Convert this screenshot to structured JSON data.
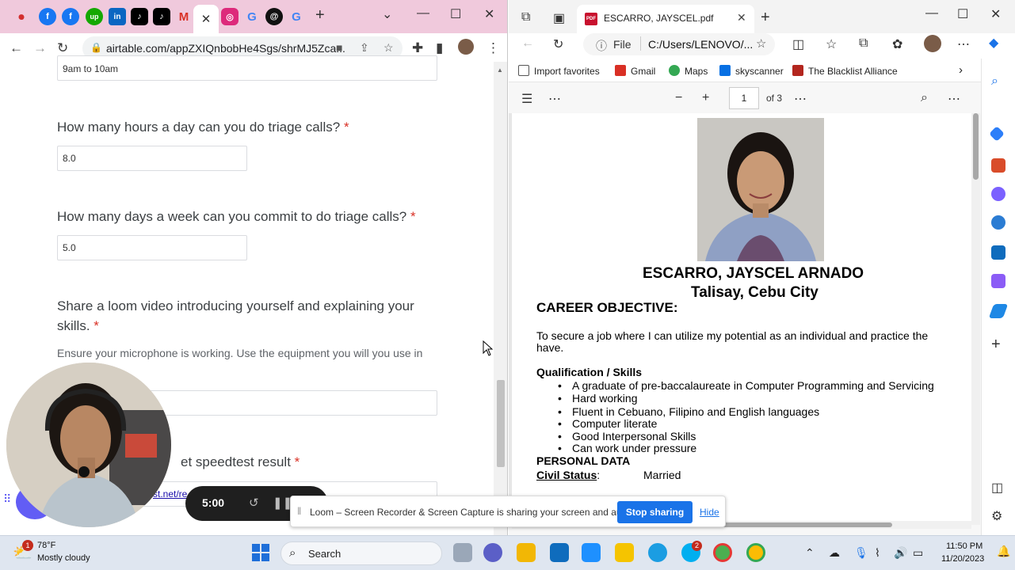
{
  "chrome": {
    "url": "airtable.com/appZXIQnbobHe4Sgs/shrMJ5Zca...",
    "tab_close": "✕",
    "window_min": "⌄",
    "window_restore": "—",
    "window_max": "☐",
    "window_close": "✕",
    "new_tab": "+"
  },
  "form": {
    "prev_answer": "9am to 10am",
    "q1_label": "How many hours a day can you do triage calls?",
    "q1_value": "8.0",
    "q2_label": "How many days a week can you commit to do triage calls?",
    "q2_value": "5.0",
    "q3_label_line1": "Share a loom video introducing yourself and explaining your",
    "q3_label_line2": "skills.",
    "q3_hint": "Ensure your microphone is working. Use the equipment you will you use in",
    "q4_label_partial": "et speedtest result",
    "q4_link_partial": "st.net/re",
    "required_mark": "*"
  },
  "loom": {
    "timer": "5:00",
    "share_message": "Loom – Screen Recorder & Screen Capture is sharing your screen and audio.",
    "stop_label": "Stop sharing",
    "hide_label": "Hide"
  },
  "edge": {
    "tab_title": "ESCARRO, JAYSCEL.pdf",
    "addr_file": "File",
    "addr_path": "C:/Users/LENOVO/...",
    "favorites": [
      {
        "label": "Import favorites",
        "color": "#555555"
      },
      {
        "label": "Gmail",
        "color": "#d93025"
      },
      {
        "label": "Maps",
        "color": "#34a853"
      },
      {
        "label": "skyscanner",
        "color": "#0770e3"
      },
      {
        "label": "The Blacklist Alliance",
        "color": "#b3261e"
      }
    ],
    "pdf_page": "1",
    "pdf_of": "of 3"
  },
  "resume": {
    "name": "ESCARRO, JAYSCEL ARNADO",
    "location": "Talisay, Cebu City",
    "career_heading": "CAREER OBJECTIVE:",
    "objective_line1": "To secure a job where I can utilize my potential as an individual and practice the",
    "objective_line2": "have.",
    "skills_heading": "Qualification / Skills",
    "skills": [
      "A graduate of pre-baccalaureate in Computer Programming and Servicing",
      "Hard working",
      "Fluent in Cebuano, Filipino and English languages",
      "Computer literate",
      "Good Interpersonal Skills",
      "Can work under pressure"
    ],
    "personal_heading": "PERSONAL DATA",
    "civil_status_label": "Civil Status",
    "civil_status_colon": ":",
    "civil_status_value": "Married"
  },
  "taskbar": {
    "temperature": "78°F",
    "weather": "Mostly cloudy",
    "weather_badge": "1",
    "search_label": "Search",
    "skype_badge": "2",
    "time": "11:50 PM",
    "date": "11/20/2023"
  }
}
